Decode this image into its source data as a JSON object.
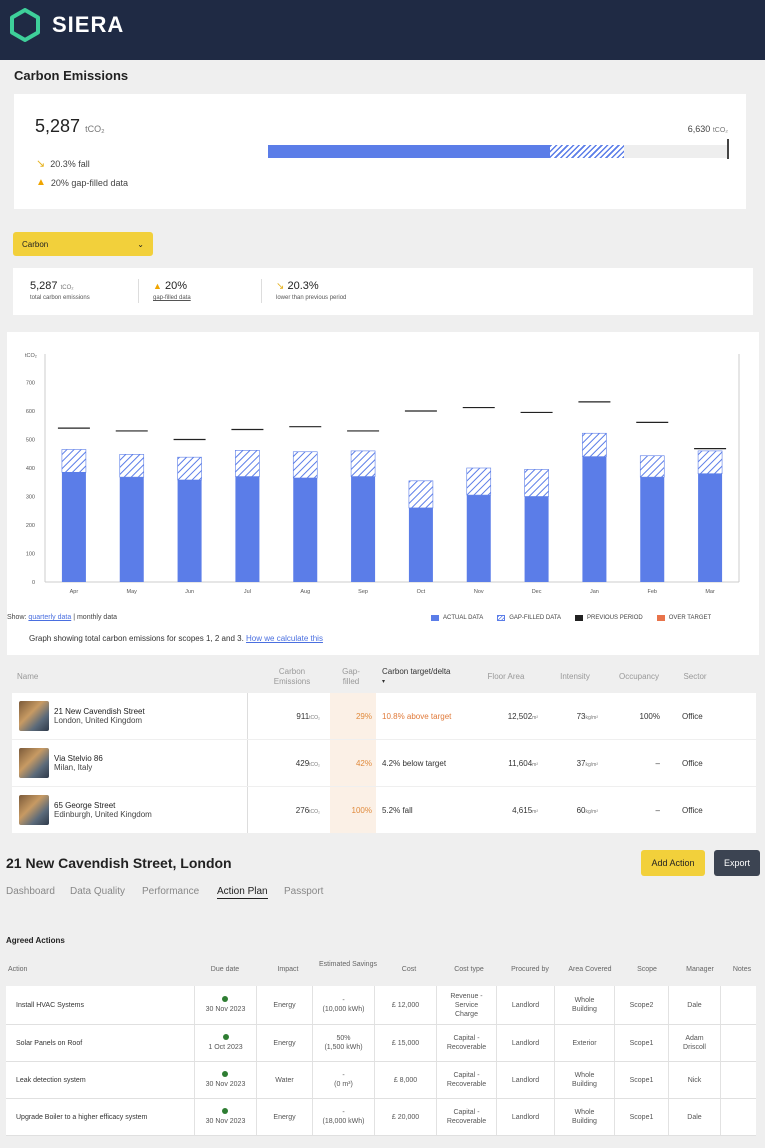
{
  "brand": {
    "name": "SIERA",
    "accent": "#3ecf9a",
    "header_bg": "#1f2a44"
  },
  "emissions": {
    "section_title": "Carbon Emissions",
    "total_value": "5,287",
    "unit": "tCO₂",
    "fall_text": "20.3% fall",
    "gap_filled_text": "20% gap-filled data",
    "target_value": "6,630",
    "target_unit": "tCO₂",
    "progress_actual_fraction": 0.797,
    "progress_gap_fraction": 0.16
  },
  "metric_dropdown": {
    "selected": "Carbon"
  },
  "summary": {
    "total_value": "5,287",
    "total_unit": "tCO₂",
    "total_label": "total carbon emissions",
    "gap_value": "20%",
    "gap_label": "gap-filled data",
    "change_value": "20.3%",
    "change_label": "lower than previous period"
  },
  "chart_data": {
    "type": "bar",
    "ylabel": "tCO₂",
    "ylim": [
      0,
      800
    ],
    "yticks": [
      0,
      100,
      200,
      300,
      400,
      500,
      600,
      700
    ],
    "categories": [
      "Apr",
      "May",
      "Jun",
      "Jul",
      "Aug",
      "Sep",
      "Oct",
      "Nov",
      "Dec",
      "Jan",
      "Feb",
      "Mar"
    ],
    "series": [
      {
        "name": "ACTUAL DATA",
        "color": "#5b7de8",
        "values": [
          385,
          368,
          358,
          370,
          365,
          370,
          260,
          305,
          300,
          440,
          368,
          380
        ]
      },
      {
        "name": "GAP-FILLED DATA",
        "color": "#5b7de8",
        "values": [
          80,
          80,
          80,
          92,
          92,
          90,
          95,
          95,
          95,
          82,
          75,
          80
        ]
      },
      {
        "name": "PREVIOUS PERIOD",
        "color": "#222222",
        "values": [
          540,
          530,
          500,
          535,
          545,
          530,
          600,
          612,
          595,
          632,
          560,
          468
        ]
      }
    ],
    "legend": [
      "ACTUAL DATA",
      "GAP-FILLED DATA",
      "PREVIOUS PERIOD",
      "OVER TARGET"
    ],
    "over_target_color": "#e8734a",
    "legend_placement": "bottom-right",
    "grid": false
  },
  "chart_footer": {
    "show_label": "Show:",
    "quarterly": "quarterly data",
    "separator": "|",
    "monthly": "monthly data",
    "caption": "Graph showing total carbon emissions for scopes 1, 2 and 3.",
    "link": "How we calculate this"
  },
  "buildings_table": {
    "headers": {
      "name": "Name",
      "emissions": [
        "Carbon",
        "Emissions"
      ],
      "gap": [
        "Gap-",
        "filled"
      ],
      "target": "Carbon target/delta",
      "area": "Floor Area",
      "intensity": "Intensity",
      "occupancy": "Occupancy",
      "sector": "Sector"
    },
    "rows": [
      {
        "name": "21 New Cavendish Street",
        "location": "London, United Kingdom",
        "emissions": "911",
        "unit": "tCO₂",
        "gap": "29%",
        "target": "10.8% above target",
        "area": "12,502",
        "area_unit": "m²",
        "intensity": "73",
        "intensity_unit": "kg/m²",
        "occupancy": "100%",
        "sector": "Office"
      },
      {
        "name": "Via Stelvio 86",
        "location": "Milan, Italy",
        "emissions": "429",
        "unit": "tCO₂",
        "gap": "42%",
        "target": "4.2% below target",
        "area": "11,604",
        "area_unit": "m²",
        "intensity": "37",
        "intensity_unit": "kg/m²",
        "occupancy": "–",
        "sector": "Office"
      },
      {
        "name": "65 George Street",
        "location": "Edinburgh, United Kingdom",
        "emissions": "276",
        "unit": "tCO₂",
        "gap": "100%",
        "target": "5.2% fall",
        "area": "4,615",
        "area_unit": "m²",
        "intensity": "60",
        "intensity_unit": "kg/m²",
        "occupancy": "–",
        "sector": "Office"
      }
    ]
  },
  "building_detail": {
    "title": "21 New Cavendish Street, London",
    "add_action": "Add Action",
    "export": "Export",
    "tabs": [
      "Dashboard",
      "Data Quality",
      "Performance",
      "Action Plan",
      "Passport"
    ],
    "active_tab": "Action Plan"
  },
  "actions": {
    "title": "Agreed Actions",
    "headers": [
      "Action",
      "Due date",
      "Impact",
      "Estimated Savings",
      "Cost",
      "Cost type",
      "Procured by",
      "Area Covered",
      "Scope",
      "Manager",
      "Notes"
    ],
    "rows": [
      {
        "action": "Install HVAC Systems",
        "due": "30 Nov 2023",
        "impact": "Energy",
        "savings": [
          "-",
          "(10,000 kWh)"
        ],
        "cost": "£ 12,000",
        "cost_type": [
          "Revenue -",
          "Service",
          "Charge"
        ],
        "procured": "Landlord",
        "area": [
          "Whole",
          "Building"
        ],
        "scope": "Scope2",
        "manager": [
          "Dale"
        ]
      },
      {
        "action": "Solar Panels on Roof",
        "due": "1 Oct 2023",
        "impact": "Energy",
        "savings": [
          "50%",
          "(1,500 kWh)"
        ],
        "cost": "£ 15,000",
        "cost_type": [
          "Capital -",
          "Recoverable"
        ],
        "procured": "Landlord",
        "area": [
          "Exterior"
        ],
        "scope": "Scope1",
        "manager": [
          "Adam",
          "Driscoll"
        ]
      },
      {
        "action": "Leak detection system",
        "due": "30 Nov 2023",
        "impact": "Water",
        "savings": [
          "-",
          "(0 m³)"
        ],
        "cost": "£ 8,000",
        "cost_type": [
          "Capital -",
          "Recoverable"
        ],
        "procured": "Landlord",
        "area": [
          "Whole",
          "Building"
        ],
        "scope": "Scope1",
        "manager": [
          "Nick"
        ]
      },
      {
        "action": "Upgrade Boiler to a higher efficacy system",
        "due": "30 Nov 2023",
        "impact": "Energy",
        "savings": [
          "-",
          "(18,000 kWh)"
        ],
        "cost": "£ 20,000",
        "cost_type": [
          "Capital -",
          "Recoverable"
        ],
        "procured": "Landlord",
        "area": [
          "Whole",
          "Building"
        ],
        "scope": "Scope1",
        "manager": [
          "Dale"
        ]
      }
    ]
  }
}
